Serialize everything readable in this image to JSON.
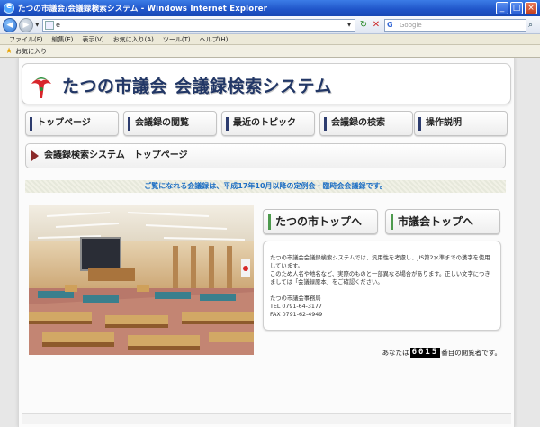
{
  "window": {
    "title": "たつの市議会/会議録検索システム - Windows Internet Explorer"
  },
  "browser": {
    "address": "e",
    "search_placeholder": "Google",
    "menu": [
      "ファイル(F)",
      "編集(E)",
      "表示(V)",
      "お気に入り(A)",
      "ツール(T)",
      "ヘルプ(H)"
    ],
    "favorites_label": "お気に入り"
  },
  "site": {
    "title_part1": "たつの市議会",
    "title_part2": "会議録検索システム"
  },
  "nav": {
    "items": [
      "トップページ",
      "会議録の閲覧",
      "最近のトピック",
      "会議録の検索",
      "操作説明"
    ]
  },
  "breadcrumb": "会議録検索システム　トップページ",
  "notice": "ご覧になれる会議録は、平成17年10月以降の定例会・臨時会会議録です。",
  "links": {
    "city_top": "たつの市トップへ",
    "council_top": "市議会トップへ"
  },
  "info": {
    "line1": "たつの市議会会議録検索システムでは、汎用性を考慮し、JIS第2水準までの漢字を使用しています。",
    "line2": "このため人名や地名など、実際のものと一部異なる場合があります。正しい文字につきましては「会議録原本」をご確認ください。",
    "office": "たつの市議会事務局",
    "tel": "TEL 0791-64-3177",
    "fax": "FAX 0791-62-4949"
  },
  "counter": {
    "prefix": "あなたは",
    "value": "6015",
    "suffix": "番目の閲覧者です。"
  },
  "colors": {
    "title_navy": "#223766",
    "notice_blue": "#1e6fc4",
    "nav_marker": "#2d3c6e",
    "link_marker": "#4d9a4d",
    "crumb_arrow": "#8a2a2a"
  }
}
